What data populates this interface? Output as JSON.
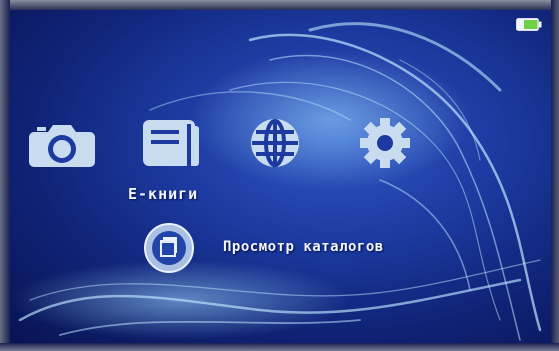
{
  "status_bar": {
    "battery_icon": "battery-icon"
  },
  "menu": {
    "items": [
      {
        "icon": "camera-icon"
      },
      {
        "icon": "book-icon"
      },
      {
        "icon": "globe-icon"
      },
      {
        "icon": "gear-icon"
      }
    ],
    "selected_caption": "E-книги"
  },
  "submenu": {
    "icon": "catalog-icon",
    "label": "Просмотр каталогов"
  },
  "colors": {
    "background": "#1c3aa0",
    "icon_fill": "#c9dcef",
    "battery": "#6fd14a"
  }
}
